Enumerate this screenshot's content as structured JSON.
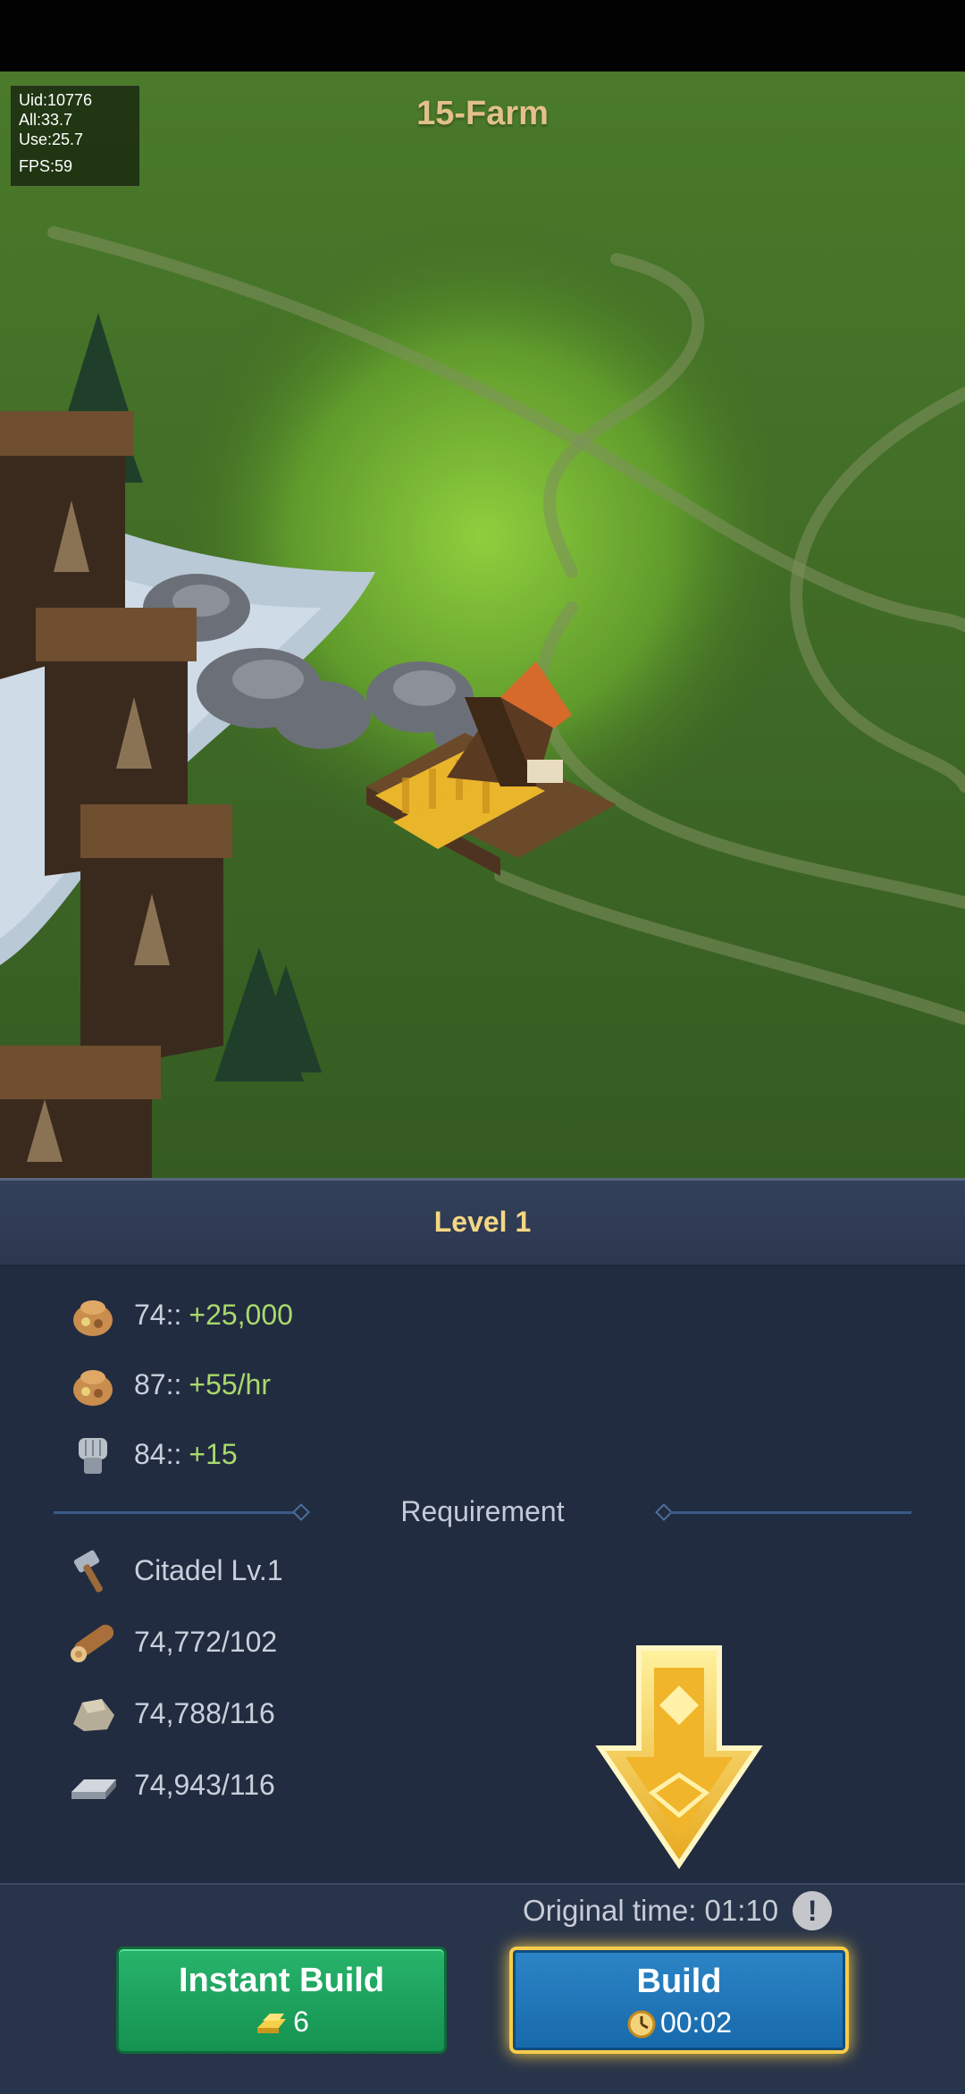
{
  "debug": {
    "uid": "Uid:10776",
    "all": "All:33.7",
    "use": "Use:25.7",
    "fps": "FPS:59"
  },
  "building_title": "15-Farm",
  "level_title": "Level 1",
  "benefits": [
    {
      "icon": "food-sack-icon",
      "label": "74::",
      "value": "+25,000"
    },
    {
      "icon": "food-sack-icon",
      "label": "87::",
      "value": "+55/hr"
    },
    {
      "icon": "fist-icon",
      "label": "84::",
      "value": "+15"
    }
  ],
  "requirement_label": "Requirement",
  "requirements": [
    {
      "icon": "hammer-icon",
      "text": "Citadel Lv.1"
    },
    {
      "icon": "wood-log-icon",
      "text": "74,772/102"
    },
    {
      "icon": "stone-icon",
      "text": "74,788/116"
    },
    {
      "icon": "iron-ingot-icon",
      "text": "74,943/116"
    }
  ],
  "original_time": "Original time: 01:10",
  "info_icon_glyph": "!",
  "instant_build": {
    "label": "Instant Build",
    "cost": "6"
  },
  "build": {
    "label": "Build",
    "time": "00:02"
  },
  "colors": {
    "accent_gold": "#f4d684",
    "benefit_green": "#a9d96b",
    "instant_green": "#1fa45e",
    "build_blue": "#2079bb"
  }
}
